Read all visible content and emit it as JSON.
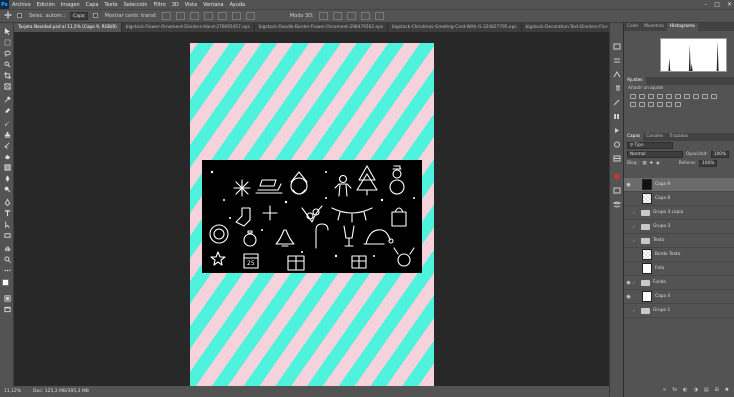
{
  "menubar": {
    "logo": "Ps",
    "items": [
      "Archivo",
      "Edición",
      "Imagen",
      "Capa",
      "Texto",
      "Selección",
      "Filtro",
      "3D",
      "Vista",
      "Ventana",
      "Ayuda"
    ]
  },
  "options": {
    "auto_select_label": "Selec. autom.:",
    "auto_select_value": "Capa",
    "transform_label": "Mostrar contr. transf.",
    "mode_3d": "Modo 3D:"
  },
  "tabs": [
    "Tarjeta Navidad.psd al 11,5% (Capa 9, RGB/8)",
    "bigstock-Flower-Ornament-Dividers-Hand-276695457.eps",
    "bigstock-Doodle-Border-Flower-Ornament-298479562.eps",
    "bigstock-Christmas-Greeting-Card-With-G-324827795.eps",
    "bigstock-Decoration-Text-Dividers-Flor-318"
  ],
  "status": {
    "zoom": "11,12%",
    "doc": "Doc: 125,2 MB/395,3 MB"
  },
  "panels": {
    "top_tabs": [
      "Color",
      "Muestras",
      "Histograma"
    ],
    "adjust_title": "Ajustes",
    "adjust_hint": "Añadir un ajuste",
    "layer_tabs": [
      "Capas",
      "Canales",
      "Trazados"
    ],
    "filter_label": "Tipo",
    "blend_mode": "Normal",
    "opacity_label": "Opacidad:",
    "opacity_value": "100%",
    "lock_label": "Bloq.:",
    "fill_label": "Relleno:",
    "fill_value": "100%"
  },
  "layers": [
    {
      "name": "Capa 9",
      "kind": "dark",
      "visible": true,
      "selected": true
    },
    {
      "name": "Capa 8",
      "kind": "trans",
      "visible": false,
      "selected": false
    },
    {
      "name": "Grupo 3 copia",
      "kind": "folder",
      "visible": false,
      "selected": false
    },
    {
      "name": "Grupo 3",
      "kind": "folder",
      "visible": false,
      "selected": false
    },
    {
      "name": "Texto",
      "kind": "folder",
      "visible": false,
      "selected": false
    },
    {
      "name": "Borde Texto",
      "kind": "trans",
      "visible": false,
      "selected": false
    },
    {
      "name": "Foto",
      "kind": "white",
      "visible": false,
      "selected": false
    },
    {
      "name": "Fondo",
      "kind": "folder",
      "visible": true,
      "selected": false
    },
    {
      "name": "Capa 4",
      "kind": "white",
      "visible": true,
      "selected": false
    },
    {
      "name": "Grupo 1",
      "kind": "folder",
      "visible": false,
      "selected": false
    }
  ],
  "artwork": {
    "date_label": "25"
  },
  "colors": {
    "stripe_pink": "#f5d2dc",
    "stripe_teal": "#4ff2dd",
    "ui_gray": "#535353",
    "canvas_bg": "#282828"
  }
}
